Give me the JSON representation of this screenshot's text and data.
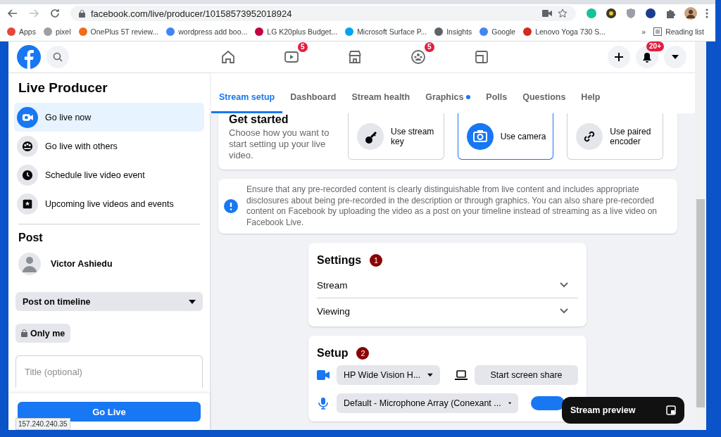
{
  "browser": {
    "url": "facebook.com/live/producer/10158573952018924",
    "bookmarks": [
      {
        "label": "Apps",
        "color": "#e8453c"
      },
      {
        "label": "pixel",
        "color": "#9aa0a6"
      },
      {
        "label": "OnePlus 5T review...",
        "color": "#f26b1d"
      },
      {
        "label": "wordpress add boo...",
        "color": "#4285f4"
      },
      {
        "label": "LG K20plus Budget...",
        "color": "#c5003e"
      },
      {
        "label": "Microsoft Surface P...",
        "color": "#00a4ef"
      },
      {
        "label": "Insights",
        "color": "#5f6368"
      },
      {
        "label": "Google",
        "color": "#4285f4"
      },
      {
        "label": "Lenovo Yoga 730 S...",
        "color": "#d52b1e"
      }
    ],
    "overflow": "»",
    "reading_list": "Reading list"
  },
  "nav": {
    "video_badge": "5",
    "groups_badge": "5",
    "notifications_badge": "20+"
  },
  "sidebar": {
    "title": "Live Producer",
    "items": [
      {
        "label": "Go live now",
        "kind": "camera",
        "selected": true
      },
      {
        "label": "Go live with others",
        "kind": "group",
        "selected": false
      },
      {
        "label": "Schedule live video event",
        "kind": "clock",
        "selected": false
      },
      {
        "label": "Upcoming live videos and events",
        "kind": "calendar",
        "selected": false
      }
    ],
    "post_title": "Post",
    "user_name": "Victor Ashiedu",
    "destination": "Post on timeline",
    "privacy": "Only me",
    "title_placeholder": "Title (optional)",
    "go_live": "Go Live"
  },
  "tabs": [
    {
      "label": "Stream setup",
      "selected": true,
      "dot": false
    },
    {
      "label": "Dashboard",
      "selected": false,
      "dot": false
    },
    {
      "label": "Stream health",
      "selected": false,
      "dot": false
    },
    {
      "label": "Graphics",
      "selected": false,
      "dot": true
    },
    {
      "label": "Polls",
      "selected": false,
      "dot": false
    },
    {
      "label": "Questions",
      "selected": false,
      "dot": false
    },
    {
      "label": "Help",
      "selected": false,
      "dot": false
    }
  ],
  "get_started": {
    "title": "Get started",
    "description": "Choose how you want to start setting up your live video.",
    "options": [
      {
        "label": "Use stream key",
        "kind": "key",
        "selected": false
      },
      {
        "label": "Use camera",
        "kind": "camera",
        "selected": true
      },
      {
        "label": "Use paired encoder",
        "kind": "link",
        "selected": false
      }
    ]
  },
  "notice": "Ensure that any pre-recorded content is clearly distinguishable from live content and includes appropriate disclosures about being pre-recorded in the description or through graphics. You can also share pre-recorded content on Facebook by uploading the video as a post on your timeline instead of streaming as a live video on Facebook Live.",
  "settings": {
    "title": "Settings",
    "step": "1",
    "rows": [
      {
        "label": "Stream",
        "expanded": false
      },
      {
        "label": "Viewing",
        "expanded": false
      }
    ]
  },
  "setup": {
    "title": "Setup",
    "step": "2",
    "camera": "HP Wide Vision H...",
    "screen_share": "Start screen share",
    "microphone": "Default - Microphone Array (Conexant ..."
  },
  "stream_preview": "Stream preview",
  "status_url": "157.240.240.35"
}
